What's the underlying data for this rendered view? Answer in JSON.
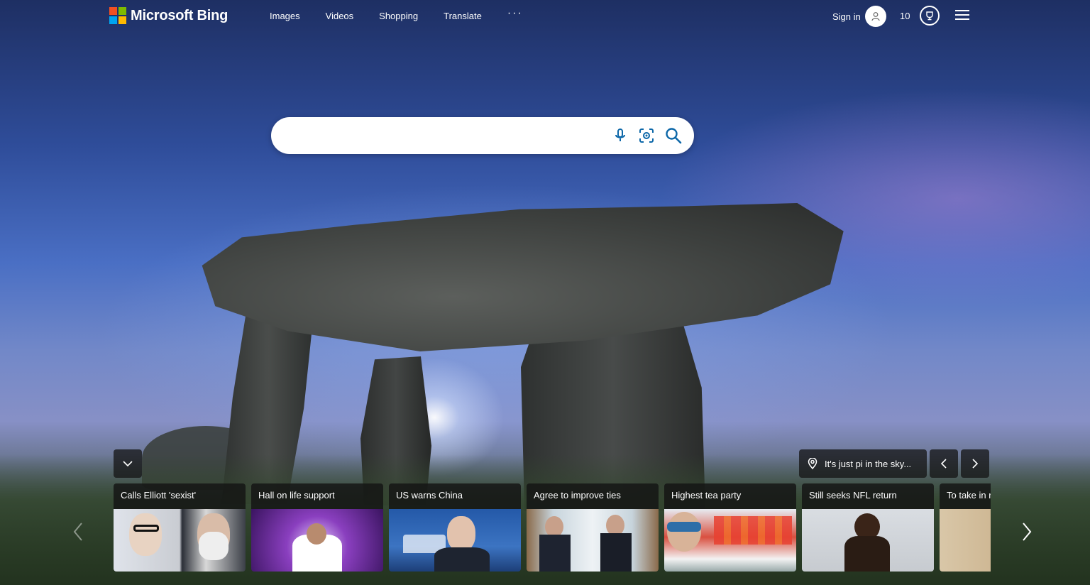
{
  "header": {
    "brand": "Microsoft Bing",
    "nav": [
      {
        "label": "Images"
      },
      {
        "label": "Videos"
      },
      {
        "label": "Shopping"
      },
      {
        "label": "Translate"
      }
    ],
    "more_label": "···",
    "signin_label": "Sign in",
    "rewards_count": "10"
  },
  "search": {
    "value": "",
    "placeholder": ""
  },
  "image_caption": {
    "text": "It's just pi in the sky..."
  },
  "news": [
    {
      "title": "Calls Elliott 'sexist'"
    },
    {
      "title": "Hall on life support"
    },
    {
      "title": "US warns China"
    },
    {
      "title": "Agree to improve ties"
    },
    {
      "title": "Highest tea party"
    },
    {
      "title": "Still seeks NFL return"
    },
    {
      "title": "To take in r"
    }
  ],
  "colors": {
    "accent": "#0c67a8",
    "card_title_bg": "#141414"
  }
}
